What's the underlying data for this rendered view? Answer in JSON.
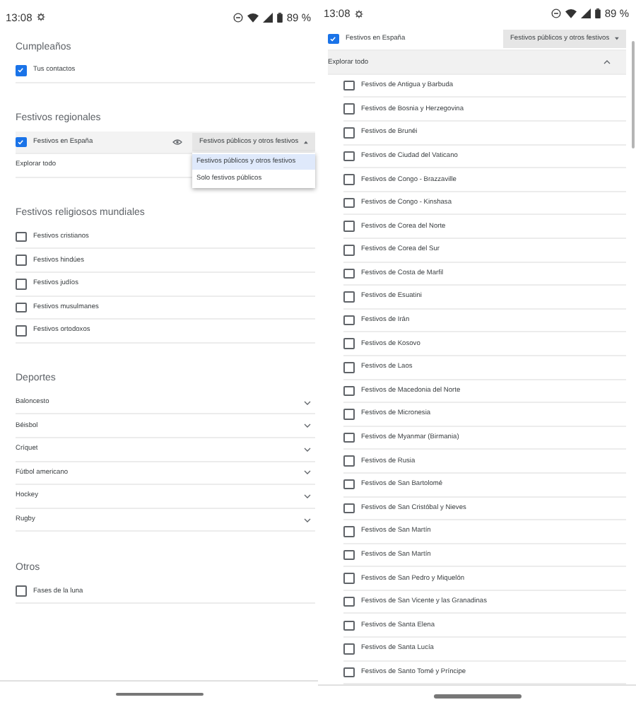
{
  "screens": [
    {
      "status_bar": {
        "time": "13:08",
        "battery": "89 %"
      },
      "sections": [
        {
          "title": "Cumpleaños",
          "items": [
            {
              "kind": "checkbox",
              "label": "Tus contactos",
              "checked": true
            }
          ]
        },
        {
          "title": "Festivos regionales",
          "items": [
            {
              "kind": "calendar",
              "label": "Festivos en España",
              "checked": true,
              "highlighted": true,
              "visibility_icon": true,
              "select": {
                "value": "Festivos públicos y otros festivos",
                "expanded": true,
                "options": [
                  {
                    "label": "Festivos públicos y otros festivos",
                    "selected": true
                  },
                  {
                    "label": "Solo festivos públicos",
                    "selected": false
                  }
                ]
              }
            },
            {
              "kind": "link",
              "label": "Explorar todo"
            }
          ]
        },
        {
          "title": "Festivos religiosos mundiales",
          "items": [
            {
              "kind": "checkbox",
              "label": "Festivos cristianos",
              "checked": false
            },
            {
              "kind": "checkbox",
              "label": "Festivos hindúes",
              "checked": false
            },
            {
              "kind": "checkbox",
              "label": "Festivos judíos",
              "checked": false
            },
            {
              "kind": "checkbox",
              "label": "Festivos musulmanes",
              "checked": false
            },
            {
              "kind": "checkbox",
              "label": "Festivos ortodoxos",
              "checked": false
            }
          ]
        },
        {
          "title": "Deportes",
          "items": [
            {
              "kind": "expander",
              "label": "Baloncesto",
              "expanded": false
            },
            {
              "kind": "expander",
              "label": "Béisbol",
              "expanded": false
            },
            {
              "kind": "expander",
              "label": "Críquet",
              "expanded": false
            },
            {
              "kind": "expander",
              "label": "Fútbol americano",
              "expanded": false
            },
            {
              "kind": "expander",
              "label": "Hockey",
              "expanded": false
            },
            {
              "kind": "expander",
              "label": "Rugby",
              "expanded": false
            }
          ]
        },
        {
          "title": "Otros",
          "items": [
            {
              "kind": "checkbox",
              "label": "Fases de la luna",
              "checked": false
            }
          ]
        }
      ]
    },
    {
      "status_bar": {
        "time": "13:08",
        "battery": "89 %"
      },
      "scrollable": true,
      "sections": [
        {
          "items": [
            {
              "kind": "calendar",
              "label": "Festivos en España",
              "checked": true,
              "highlighted": false,
              "select": {
                "value": "Festivos públicos y otros festivos",
                "expanded": false
              }
            },
            {
              "kind": "group",
              "label": "Explorar todo",
              "expanded": true,
              "children": [
                {
                  "label": "Festivos de Antigua y Barbuda",
                  "checked": false
                },
                {
                  "label": "Festivos de Bosnia y Herzegovina",
                  "checked": false
                },
                {
                  "label": "Festivos de Brunéi",
                  "checked": false
                },
                {
                  "label": "Festivos de Ciudad del Vaticano",
                  "checked": false
                },
                {
                  "label": "Festivos de Congo - Brazzaville",
                  "checked": false
                },
                {
                  "label": "Festivos de Congo - Kinshasa",
                  "checked": false
                },
                {
                  "label": "Festivos de Corea del Norte",
                  "checked": false
                },
                {
                  "label": "Festivos de Corea del Sur",
                  "checked": false
                },
                {
                  "label": "Festivos de Costa de Marfil",
                  "checked": false
                },
                {
                  "label": "Festivos de Esuatini",
                  "checked": false
                },
                {
                  "label": "Festivos de Irán",
                  "checked": false
                },
                {
                  "label": "Festivos de Kosovo",
                  "checked": false
                },
                {
                  "label": "Festivos de Laos",
                  "checked": false
                },
                {
                  "label": "Festivos de Macedonia del Norte",
                  "checked": false
                },
                {
                  "label": "Festivos de Micronesia",
                  "checked": false
                },
                {
                  "label": "Festivos de Myanmar (Birmania)",
                  "checked": false
                },
                {
                  "label": "Festivos de Rusia",
                  "checked": false
                },
                {
                  "label": "Festivos de San Bartolomé",
                  "checked": false
                },
                {
                  "label": "Festivos de San Cristóbal y Nieves",
                  "checked": false
                },
                {
                  "label": "Festivos de San Martín",
                  "checked": false
                },
                {
                  "label": "Festivos de San Martín",
                  "checked": false
                },
                {
                  "label": "Festivos de San Pedro y Miquelón",
                  "checked": false
                },
                {
                  "label": "Festivos de San Vicente y las Granadinas",
                  "checked": false
                },
                {
                  "label": "Festivos de Santa Elena",
                  "checked": false
                },
                {
                  "label": "Festivos de Santa Lucía",
                  "checked": false
                },
                {
                  "label": "Festivos de Santo Tomé y Príncipe",
                  "checked": false
                }
              ]
            }
          ]
        }
      ]
    }
  ]
}
